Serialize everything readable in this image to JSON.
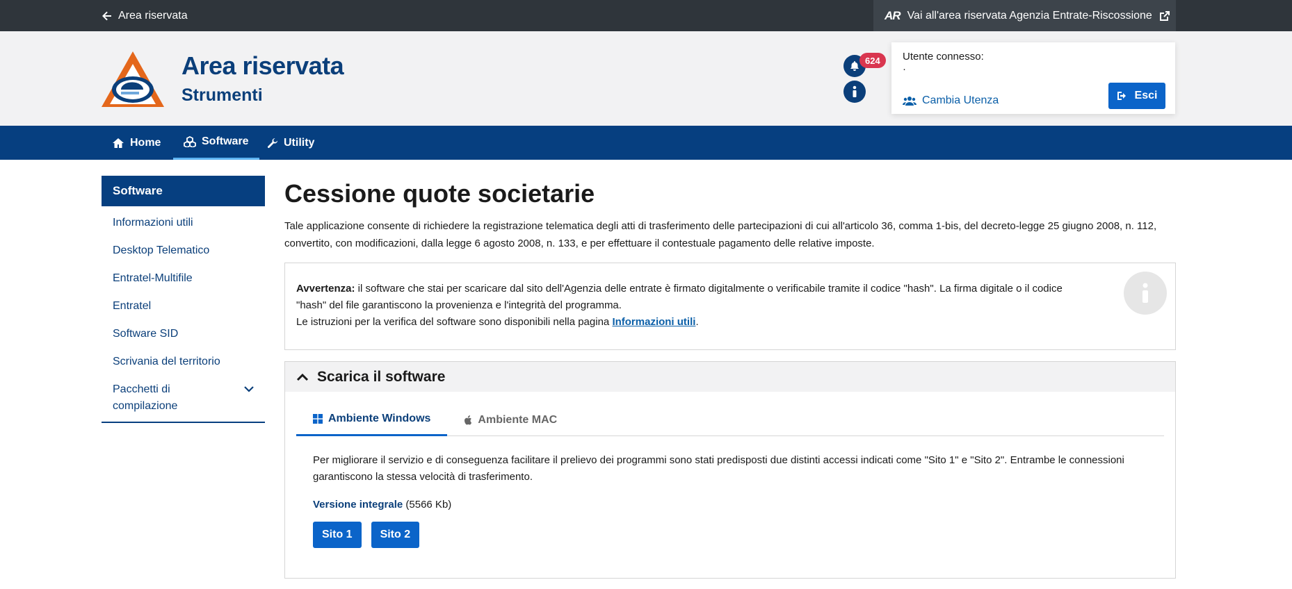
{
  "topbar": {
    "back_label": "Area riservata",
    "ader_logo_text": "AR",
    "ader_label": "Vai all'area riservata Agenzia Entrate-Riscossione"
  },
  "header": {
    "title": "Area riservata",
    "subtitle": "Strumenti",
    "notifications_count": "624",
    "user_label": "Utente connesso:",
    "user_name": "",
    "user_extra": "·",
    "switch_user_label": "Cambia Utenza",
    "logout_label": "Esci"
  },
  "nav": {
    "items": [
      {
        "label": "Home",
        "icon": "home-icon"
      },
      {
        "label": "Software",
        "icon": "cubes-icon"
      },
      {
        "label": "Utility",
        "icon": "wrench-icon"
      }
    ]
  },
  "sidebar": {
    "header": "Software",
    "items": [
      {
        "label": "Informazioni utili"
      },
      {
        "label": "Desktop Telematico"
      },
      {
        "label": "Entratel-Multifile"
      },
      {
        "label": "Entratel"
      },
      {
        "label": "Software SID"
      },
      {
        "label": "Scrivania del territorio"
      },
      {
        "label": "Pacchetti di compilazione"
      }
    ]
  },
  "main": {
    "title": "Cessione quote societarie",
    "intro": "Tale applicazione consente di richiedere la registrazione telematica degli atti di trasferimento delle partecipazioni di cui all'articolo 36, comma 1-bis, del decreto-legge 25 giugno 2008, n. 112, convertito, con modificazioni, dalla legge 6 agosto 2008, n. 133, e per effettuare il contestuale pagamento delle relative imposte.",
    "alert": {
      "strong": "Avvertenza:",
      "text": " il software che stai per scaricare dal sito dell'Agenzia delle entrate è firmato digitalmente o verificabile tramite il codice \"hash\". La firma digitale o il codice \"hash\" del file garantiscono la provenienza e l'integrità del programma.",
      "line2": "Le istruzioni per la verifica del software sono disponibili nella pagina ",
      "link": "Informazioni utili",
      "end": "."
    },
    "download": {
      "header": "Scarica il software",
      "tabs": [
        {
          "label": "Ambiente Windows",
          "icon": "windows-icon"
        },
        {
          "label": "Ambiente MAC",
          "icon": "apple-icon"
        }
      ],
      "body": "Per migliorare il servizio e di conseguenza facilitare il prelievo dei programmi sono stati predisposti due distinti accessi indicati come \"Sito 1\" e \"Sito 2\". Entrambe le connessioni garantiscono la stessa velocità di trasferimento.",
      "version_link": "Versione integrale",
      "version_size": " (5566 Kb)",
      "site1": "Sito 1",
      "site2": "Sito 2"
    }
  }
}
